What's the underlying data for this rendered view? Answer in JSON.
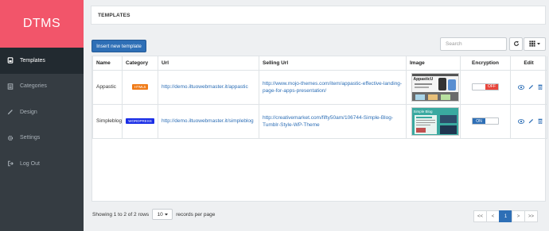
{
  "brand": "DTMS",
  "sidebar": {
    "items": [
      {
        "label": "Templates",
        "icon": "file-icon"
      },
      {
        "label": "Categories",
        "icon": "list-icon"
      },
      {
        "label": "Design",
        "icon": "pencil-icon"
      },
      {
        "label": "Settings",
        "icon": "gear-icon"
      },
      {
        "label": "Log Out",
        "icon": "logout-icon"
      }
    ]
  },
  "header": {
    "title": "TEMPLATES"
  },
  "toolbar": {
    "insert_label": "Insert new template",
    "search_placeholder": "Search"
  },
  "table": {
    "columns": [
      "Name",
      "Category",
      "Url",
      "Selling Url",
      "Image",
      "Encryption",
      "Edit"
    ],
    "rows": [
      {
        "name": "Appastic",
        "category": "HTML5",
        "category_color": "#f07b18",
        "url": "http://demo.iltuowebmaster.it/appastic",
        "selling_url": "http://www.mojo-themes.com/item/appastic-effective-landing-page-for-apps-presentation/",
        "thumb_title": "AppasticU",
        "encryption_label": "OFF",
        "encryption_on": false
      },
      {
        "name": "Simpleblog",
        "category": "WORDPRESS",
        "category_color": "#1a2ee6",
        "url": "http://demo.iltuowebmaster.it/simpleblog",
        "selling_url": "http://creativemarket.com/fifty50am/106744-Simple-Blog-Tumblr-Style-WP-Theme",
        "thumb_title": "Simple Blog",
        "encryption_label": "ON",
        "encryption_on": true
      }
    ]
  },
  "footer": {
    "showing_text": "Showing 1 to 2 of 2 rows",
    "per_page_value": "10",
    "per_page_suffix": "records per page"
  },
  "pager": [
    "<<",
    "<",
    "1",
    ">",
    ">>"
  ],
  "pager_active": "1",
  "colors": {
    "brand": "#f2556a",
    "sidebar": "#353c42",
    "sidebar_active": "#222a30",
    "primary": "#2e6fb6",
    "off": "#e8463c"
  }
}
